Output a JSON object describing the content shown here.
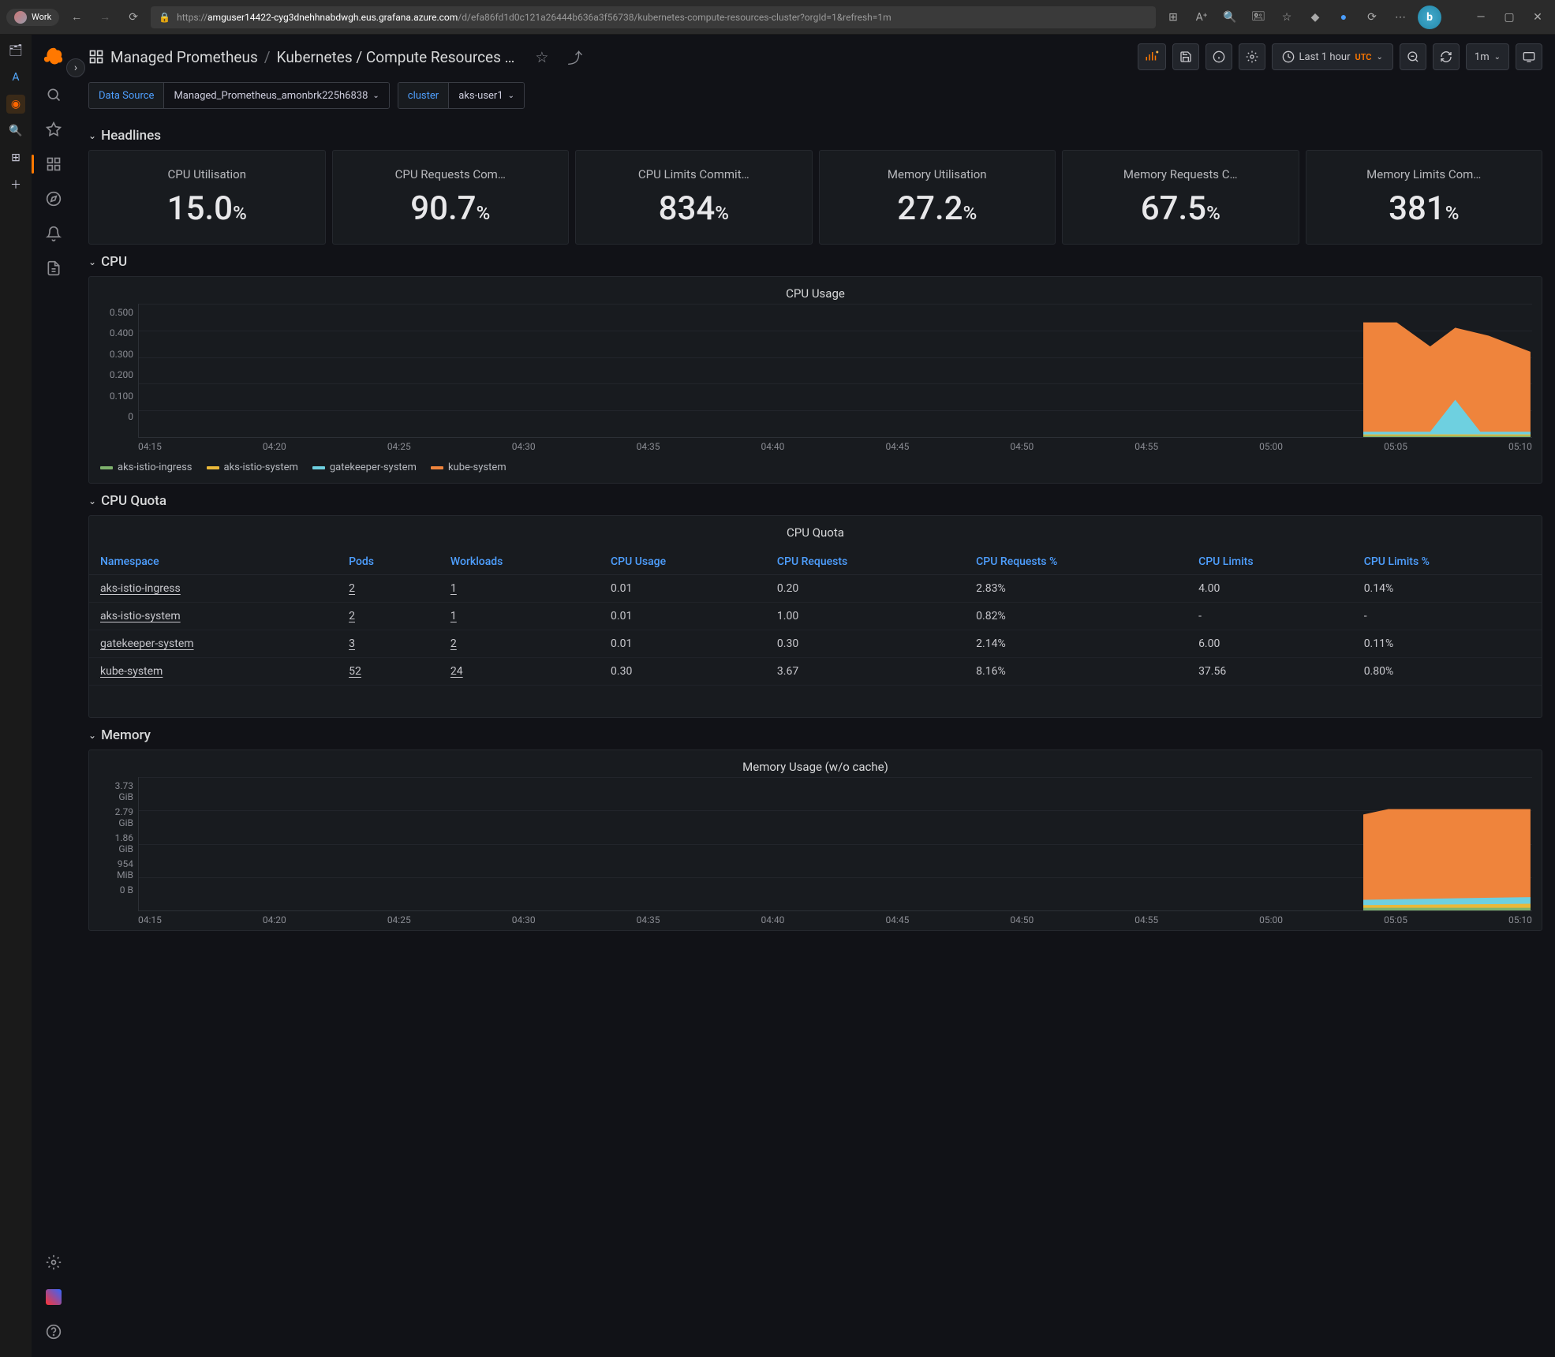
{
  "browser": {
    "profile": "Work",
    "url_prefix": "https://",
    "url_host": "amguser14422-cyg3dnehhnabdwgh.eus.grafana.azure.com",
    "url_path": "/d/efa86fd1d0c121a26444b636a3f56738/kubernetes-compute-resources-cluster?orgId=1&refresh=1m"
  },
  "breadcrumb": {
    "root": "Managed Prometheus",
    "page": "Kubernetes / Compute Resources …"
  },
  "toolbar": {
    "time_range": "Last 1 hour",
    "tz": "UTC",
    "refresh_interval": "1m"
  },
  "variables": {
    "datasource_label": "Data Source",
    "datasource_value": "Managed_Prometheus_amonbrk225h6838",
    "cluster_label": "cluster",
    "cluster_value": "aks-user1"
  },
  "rows": {
    "headlines": "Headlines",
    "cpu": "CPU",
    "cpu_quota": "CPU Quota",
    "memory": "Memory"
  },
  "headlines": [
    {
      "title": "CPU Utilisation",
      "value": "15.0",
      "unit": "%"
    },
    {
      "title": "CPU Requests Com…",
      "value": "90.7",
      "unit": "%"
    },
    {
      "title": "CPU Limits Commit…",
      "value": "834",
      "unit": "%"
    },
    {
      "title": "Memory Utilisation",
      "value": "27.2",
      "unit": "%"
    },
    {
      "title": "Memory Requests C…",
      "value": "67.5",
      "unit": "%"
    },
    {
      "title": "Memory Limits Com…",
      "value": "381",
      "unit": "%"
    }
  ],
  "chart_data": [
    {
      "id": "cpu_usage",
      "type": "area",
      "title": "CPU Usage",
      "ylabel": "",
      "ylim": [
        0,
        0.5
      ],
      "y_ticks": [
        "0.500",
        "0.400",
        "0.300",
        "0.200",
        "0.100",
        "0"
      ],
      "x_ticks": [
        "04:15",
        "04:20",
        "04:25",
        "04:30",
        "04:35",
        "04:40",
        "04:45",
        "04:50",
        "04:55",
        "05:00",
        "05:05",
        "05:10"
      ],
      "series": [
        {
          "name": "aks-istio-ingress",
          "color": "#7eb26d"
        },
        {
          "name": "aks-istio-system",
          "color": "#eab839"
        },
        {
          "name": "gatekeeper-system",
          "color": "#6ed0e0"
        },
        {
          "name": "kube-system",
          "color": "#ef843c"
        }
      ],
      "note": "data only present near 05:08–05:12; kube-system ~0.45, gatekeeper-system spikes to ~0.12"
    },
    {
      "id": "memory_usage",
      "type": "area",
      "title": "Memory Usage (w/o cache)",
      "ylabel": "",
      "y_ticks": [
        "3.73 GiB",
        "2.79 GiB",
        "1.86 GiB",
        "954 MiB",
        "0 B"
      ],
      "x_ticks": [
        "04:15",
        "04:20",
        "04:25",
        "04:30",
        "04:35",
        "04:40",
        "04:45",
        "04:50",
        "04:55",
        "05:00",
        "05:05",
        "05:10"
      ],
      "series": [
        {
          "name": "aks-istio-ingress",
          "color": "#7eb26d"
        },
        {
          "name": "aks-istio-system",
          "color": "#eab839"
        },
        {
          "name": "gatekeeper-system",
          "color": "#6ed0e0"
        },
        {
          "name": "kube-system",
          "color": "#ef843c"
        }
      ],
      "note": "data only present near 05:08–05:12; total stack ~2.8 GiB"
    }
  ],
  "cpu_quota": {
    "title": "CPU Quota",
    "columns": [
      "Namespace",
      "Pods",
      "Workloads",
      "CPU Usage",
      "CPU Requests",
      "CPU Requests %",
      "CPU Limits",
      "CPU Limits %"
    ],
    "rows": [
      {
        "ns": "aks-istio-ingress",
        "pods": "2",
        "workloads": "1",
        "usage": "0.01",
        "req": "0.20",
        "req_pct": "2.83%",
        "lim": "4.00",
        "lim_pct": "0.14%"
      },
      {
        "ns": "aks-istio-system",
        "pods": "2",
        "workloads": "1",
        "usage": "0.01",
        "req": "1.00",
        "req_pct": "0.82%",
        "lim": "-",
        "lim_pct": "-"
      },
      {
        "ns": "gatekeeper-system",
        "pods": "3",
        "workloads": "2",
        "usage": "0.01",
        "req": "0.30",
        "req_pct": "2.14%",
        "lim": "6.00",
        "lim_pct": "0.11%"
      },
      {
        "ns": "kube-system",
        "pods": "52",
        "workloads": "24",
        "usage": "0.30",
        "req": "3.67",
        "req_pct": "8.16%",
        "lim": "37.56",
        "lim_pct": "0.80%"
      }
    ]
  },
  "legend_colors": {
    "aks-istio-ingress": "#7eb26d",
    "aks-istio-system": "#eab839",
    "gatekeeper-system": "#6ed0e0",
    "kube-system": "#ef843c"
  }
}
